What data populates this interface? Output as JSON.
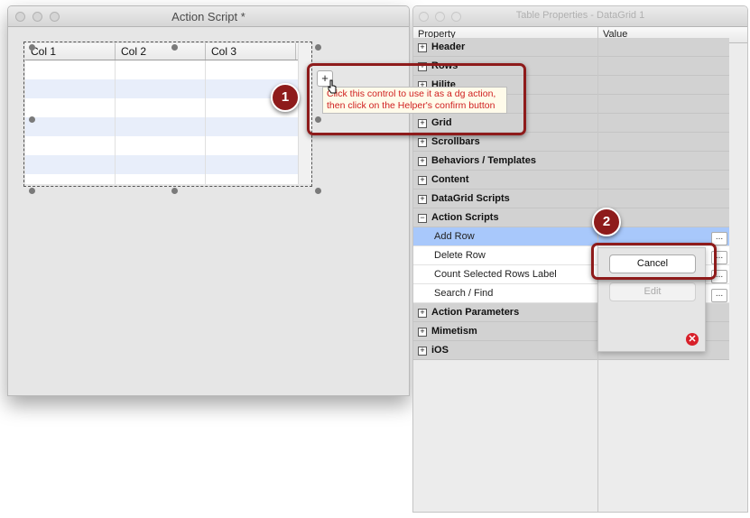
{
  "left_window": {
    "title": "Action Script *",
    "grid": {
      "columns": [
        "Col 1",
        "Col 2",
        "Col 3"
      ]
    },
    "plus_button_label": "+",
    "tooltip_lines": [
      "Click this control to use it as a dg action,",
      "then click on the Helper's confirm button"
    ]
  },
  "callouts": [
    {
      "number": "1"
    },
    {
      "number": "2"
    }
  ],
  "right_window": {
    "title": "Table Properties - DataGrid 1",
    "col_headers": {
      "property": "Property",
      "value": "Value"
    },
    "sections": [
      {
        "label": "Header",
        "expanded": false
      },
      {
        "label": "Rows",
        "expanded": false
      },
      {
        "label": "Hilite",
        "expanded": false
      },
      {
        "label": "",
        "expanded": false
      },
      {
        "label": "Grid",
        "expanded": false
      },
      {
        "label": "Scrollbars",
        "expanded": false
      },
      {
        "label": "Behaviors / Templates",
        "expanded": false
      },
      {
        "label": "Content",
        "expanded": false
      },
      {
        "label": "DataGrid Scripts",
        "expanded": false
      },
      {
        "label": "Action Scripts",
        "expanded": true
      }
    ],
    "action_scripts": [
      {
        "label": "Add Row",
        "selected": true
      },
      {
        "label": "Delete Row",
        "selected": false
      },
      {
        "label": "Count Selected Rows Label",
        "selected": false
      },
      {
        "label": "Search / Find",
        "selected": false
      }
    ],
    "more_sections": [
      {
        "label": "Action Parameters"
      },
      {
        "label": "Mimetism"
      },
      {
        "label": "iOS"
      }
    ],
    "ellipsis_label": "...",
    "popup": {
      "cancel_label": "Cancel",
      "edit_label": "Edit"
    }
  },
  "colors": {
    "callout": "#8e1b1b",
    "selection": "#a8c8fb",
    "tooltip_text": "#d02020"
  }
}
